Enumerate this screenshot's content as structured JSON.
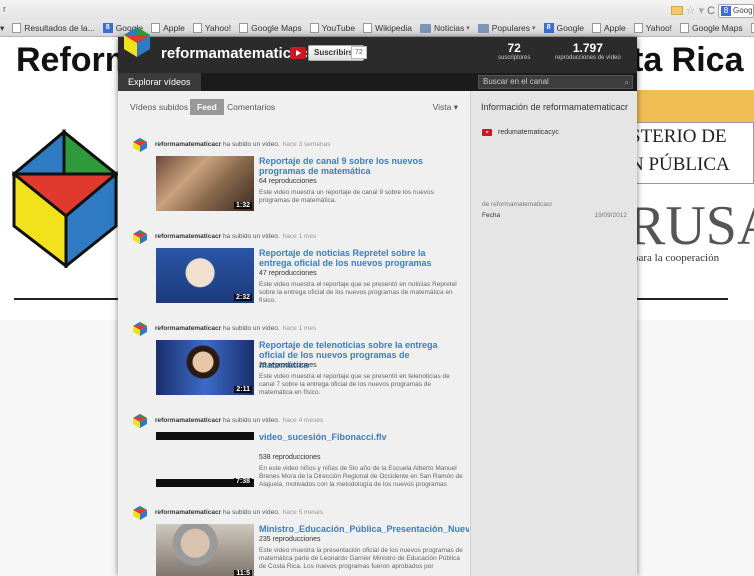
{
  "browser": {
    "top_left_char": "r",
    "bookmarks": [
      {
        "label": "Resultados de la...",
        "type": "doc"
      },
      {
        "label": "Google",
        "type": "google"
      },
      {
        "label": "Apple",
        "type": "doc"
      },
      {
        "label": "Yahoo!",
        "type": "doc"
      },
      {
        "label": "Google Maps",
        "type": "doc"
      },
      {
        "label": "YouTube",
        "type": "doc"
      },
      {
        "label": "Wikipedia",
        "type": "doc"
      },
      {
        "label": "Noticias",
        "type": "folder"
      },
      {
        "label": "Populares",
        "type": "folder"
      },
      {
        "label": "Google",
        "type": "google"
      },
      {
        "label": "Apple",
        "type": "doc"
      },
      {
        "label": "Yahoo!",
        "type": "doc"
      },
      {
        "label": "Google Maps",
        "type": "doc"
      },
      {
        "label": "YouT",
        "type": "doc"
      }
    ],
    "search_box_text": "Goog"
  },
  "background_page": {
    "title_left": "Reform",
    "title_right": "ta Rica",
    "ministry_line1": "STERIO DE",
    "ministry_line2": "N PÚBLICA",
    "rusa": "RUSA",
    "cooperation": "para la cooperación"
  },
  "channel": {
    "name": "reformamatematicacr",
    "subscribe_label": "Suscribirse",
    "subscriber_badge": "72",
    "subscribers_count": "72",
    "subscribers_label": "suscriptores",
    "views_count": "1.797",
    "views_label": "reproducciones de vídeo",
    "nav_tab": "Explorar vídeos",
    "search_placeholder": "Buscar en el canal",
    "subtabs": {
      "uploaded": "Vídeos subidos",
      "feed": "Feed",
      "comments": "Comentarios",
      "view": "Vista"
    },
    "feed": [
      {
        "user": "reformamatematicacr",
        "action": "ha subido un vídeo.",
        "ago": "hace 3 semanas",
        "title": "Reportaje de canal 9 sobre los nuevos programas de matemática",
        "views": "64 reproducciones",
        "desc": "Este video muestra un reportaje de canal 9 sobre los nuevos programas de matemática.",
        "duration": "1:32"
      },
      {
        "user": "reformamatematicacr",
        "action": "ha subido un vídeo.",
        "ago": "hace 1 mes",
        "title": "Reportaje de noticias Repretel sobre la entrega oficial de los nuevos programas",
        "views": "47 reproducciones",
        "desc": "Este video muestra el reportaje que se presentó en noticias Repretel sobre la entrega oficial de los nuevos programas de matemática en físico.",
        "duration": "2:32"
      },
      {
        "user": "reformamatematicacr",
        "action": "ha subido un vídeo.",
        "ago": "hace 1 mes",
        "title": "Reportaje de telenoticias sobre la entrega oficial de los nuevos programas de matemática",
        "views": "29 reproducciones",
        "desc": "Este video muestra el reportaje que se presentó en telenoticias de canal 7 sobre la entrega oficial de los nuevos programas de matemática en físico.",
        "duration": "2:11"
      },
      {
        "user": "reformamatematicacr",
        "action": "ha subido un vídeo.",
        "ago": "hace 4 meses",
        "title": "video_sucesión_Fibonacci.flv",
        "views": "538 reproducciones",
        "desc": "En este video niños y niñas de 5to año de la Escuela Alberto Manuel Brenes Mora de la Dirección Regional de Occidente en San Ramón de Alajuela, motivados con la metodología de los nuevos programas",
        "duration": "7:38"
      },
      {
        "user": "reformamatematicacr",
        "action": "ha subido un vídeo.",
        "ago": "hace 5 meses",
        "title": "Ministro_Educación_Pública_Presentación_Nuevos_Pro",
        "views": "235 reproducciones",
        "desc": "Este video muestra la presentación oficial de los nuevos programas de matemática parte de Leonardo Garnier Ministro de Educación Pública de Costa Rica. Los nuevos programas fueron aprobados por",
        "duration": "11:5"
      }
    ],
    "sidebar": {
      "title": "Información de reformamatematicacr",
      "link": "redumatematicacyc",
      "from": "de reformamatematicacr",
      "date_label": "Fecha",
      "date_value": "19/09/2012"
    }
  }
}
